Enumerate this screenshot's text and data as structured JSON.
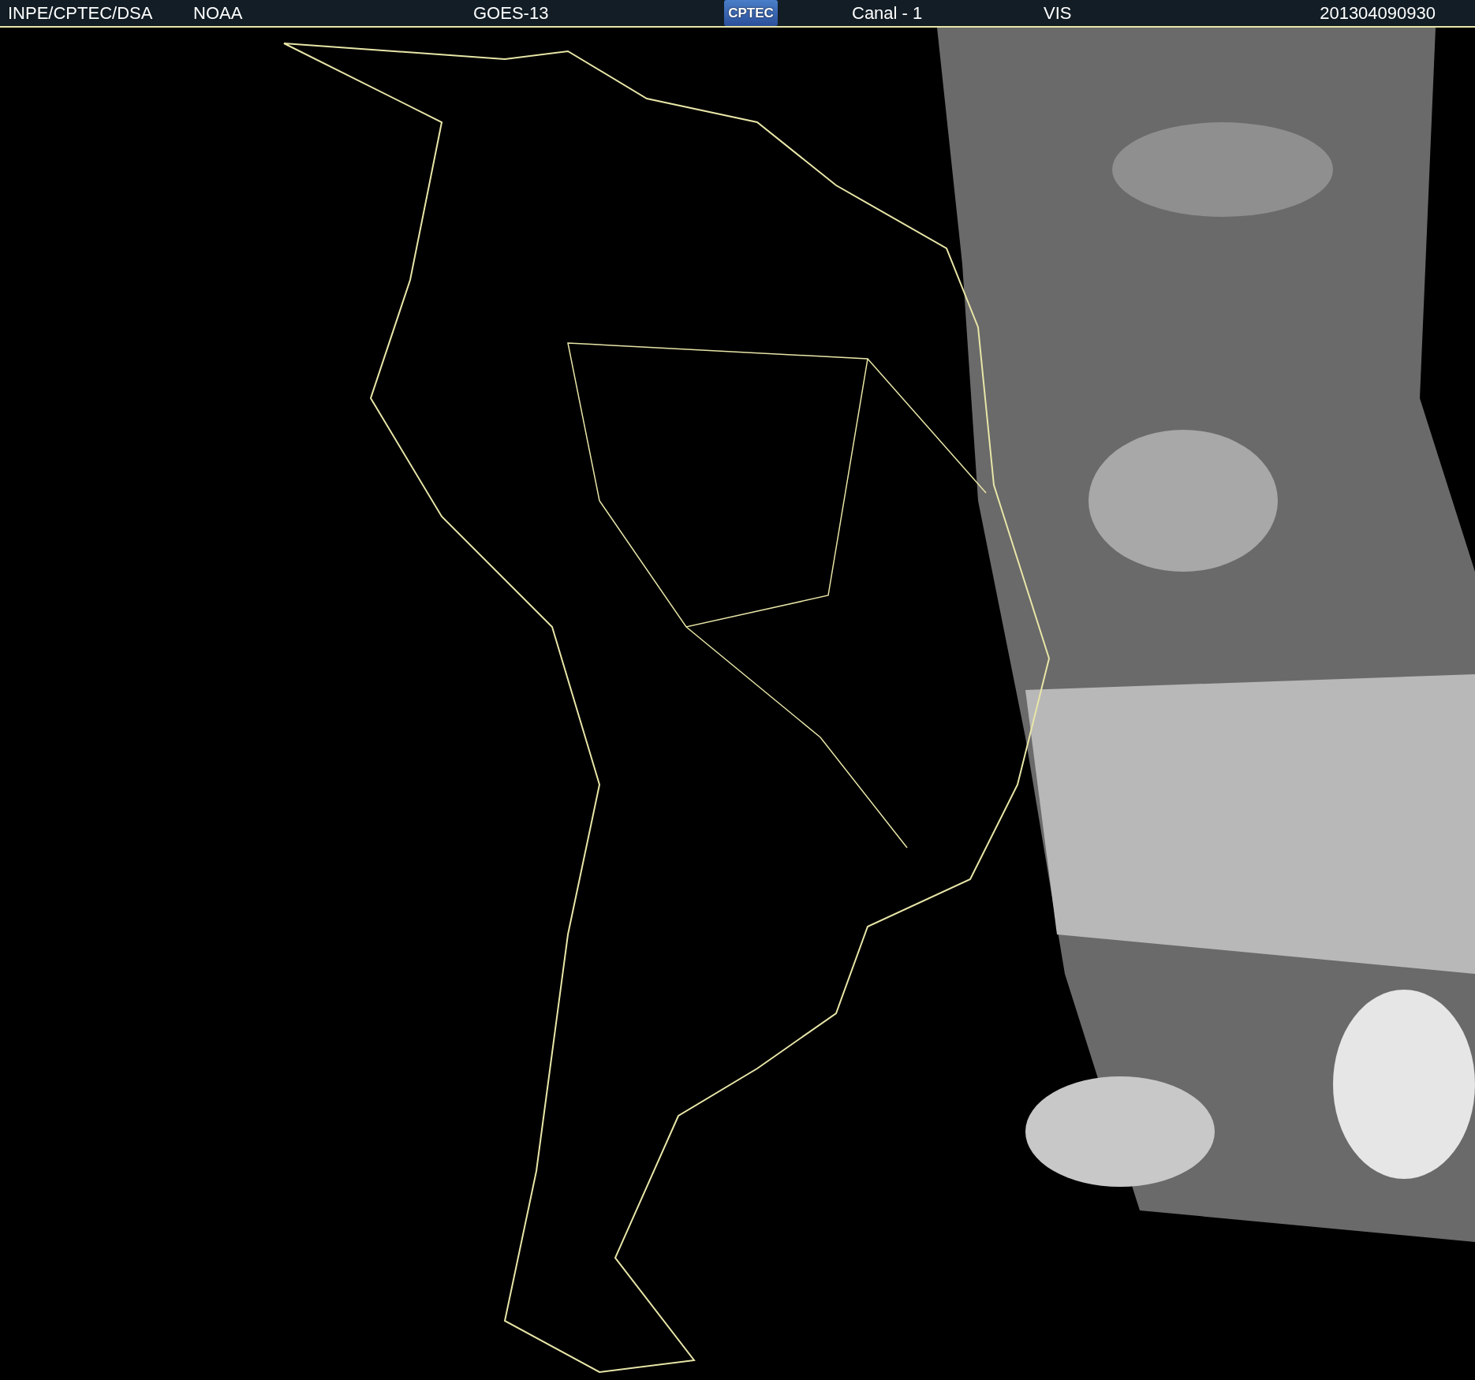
{
  "header": {
    "source": "INPE/CPTEC/DSA",
    "agency": "NOAA",
    "satellite": "GOES-13",
    "logo": "CPTEC",
    "channel": "Canal - 1",
    "band": "VIS",
    "timestamp": "201304090930"
  }
}
